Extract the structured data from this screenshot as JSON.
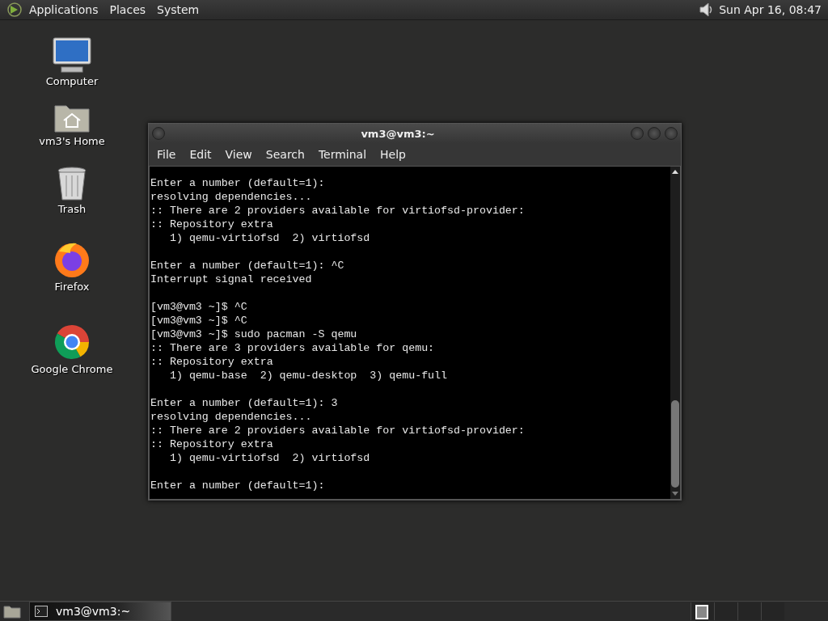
{
  "top_panel": {
    "menus": [
      "Applications",
      "Places",
      "System"
    ],
    "clock": "Sun Apr 16, 08:47"
  },
  "desktop_icons": [
    {
      "kind": "computer",
      "label": "Computer"
    },
    {
      "kind": "home",
      "label": "vm3's Home"
    },
    {
      "kind": "trash",
      "label": "Trash"
    },
    {
      "kind": "firefox",
      "label": "Firefox"
    },
    {
      "kind": "chrome",
      "label": "Google Chrome"
    }
  ],
  "terminal": {
    "title": "vm3@vm3:~",
    "menu": [
      "File",
      "Edit",
      "View",
      "Search",
      "Terminal",
      "Help"
    ],
    "blocks": [
      [
        "Enter a number (default=1):",
        "resolving dependencies...",
        ":: There are 2 providers available for virtiofsd-provider:",
        ":: Repository extra",
        "   1) qemu-virtiofsd  2) virtiofsd"
      ],
      [
        "Enter a number (default=1): ^C",
        "Interrupt signal received"
      ],
      [
        "[vm3@vm3 ~]$ ^C",
        "[vm3@vm3 ~]$ ^C",
        "[vm3@vm3 ~]$ sudo pacman -S qemu",
        ":: There are 3 providers available for qemu:",
        ":: Repository extra",
        "   1) qemu-base  2) qemu-desktop  3) qemu-full"
      ],
      [
        "Enter a number (default=1): 3",
        "resolving dependencies...",
        ":: There are 2 providers available for virtiofsd-provider:",
        ":: Repository extra",
        "   1) qemu-virtiofsd  2) virtiofsd"
      ],
      [
        "Enter a number (default=1):"
      ]
    ]
  },
  "bottom_panel": {
    "task": "vm3@vm3:~",
    "workspaces": [
      {
        "selected": true
      },
      {
        "selected": false
      },
      {
        "selected": false
      },
      {
        "selected": false
      }
    ]
  }
}
